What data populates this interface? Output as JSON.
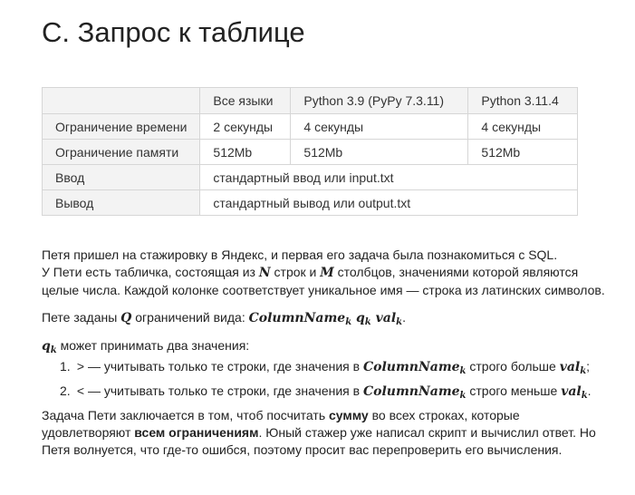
{
  "problem": {
    "title": "C. Запрос к таблице"
  },
  "limits_table": {
    "headers": [
      "",
      "Все языки",
      "Python 3.9 (PyPy 7.3.11)",
      "Python 3.11.4"
    ],
    "rows": [
      {
        "label": "Ограничение времени",
        "cells": [
          "2 секунды",
          "4 секунды",
          "4 секунды"
        ]
      },
      {
        "label": "Ограничение памяти",
        "cells": [
          "512Mb",
          "512Mb",
          "512Mb"
        ]
      },
      {
        "label": "Ввод",
        "span_value": "стандартный ввод или input.txt"
      },
      {
        "label": "Вывод",
        "span_value": "стандартный вывод или output.txt"
      }
    ]
  },
  "statement": {
    "p1_line1": "Петя пришел на стажировку в Яндекс, и первая его задача была познакомиться с SQL.",
    "p1_line2_a": "У Пети есть табличка, состоящая из ",
    "p1_N": "N",
    "p1_line2_b": " строк и ",
    "p1_M": "M",
    "p1_line2_c": " столбцов, значениями которой являются",
    "p1_line3": "целые числа. Каждой колонке соответствует уникальное имя — строка из латинских символов.",
    "p2_a": "Пете заданы ",
    "p2_Q": "Q",
    "p2_b": " ограничений вида: ",
    "p2_expr_colname": "ColumnName",
    "p2_expr_sub": "k",
    "p2_expr_q": "q",
    "p2_expr_val": "val",
    "p2_end": ".",
    "p3_q": "q",
    "p3_sub": "k",
    "p3_text": " может принимать два значения:",
    "items": [
      {
        "num": "1.",
        "symbol": ">",
        "text_a": " — учитывать только те строки, где значения в ",
        "colname": "ColumnName",
        "sub": "k",
        "text_b": " строго больше ",
        "val": "val",
        "end": ";"
      },
      {
        "num": "2.",
        "symbol": "<",
        "text_a": " — учитывать только те строки, где значения в ",
        "colname": "ColumnName",
        "sub": "k",
        "text_b": " строго меньше ",
        "val": "val",
        "end": "."
      }
    ],
    "p4_a": "Задача Пети заключается в том, чтоб посчитать ",
    "p4_bold1": "сумму",
    "p4_b": " во всех строках, которые",
    "p4_line2_a": "удовлетворяют ",
    "p4_bold2": "всем ограничениям",
    "p4_line2_b": ". Юный стажер уже написал скрипт и вычислил ответ. Но",
    "p4_line3": "Петя волнуется, что где-то ошибся, поэтому просит вас перепроверить его вычисления."
  }
}
